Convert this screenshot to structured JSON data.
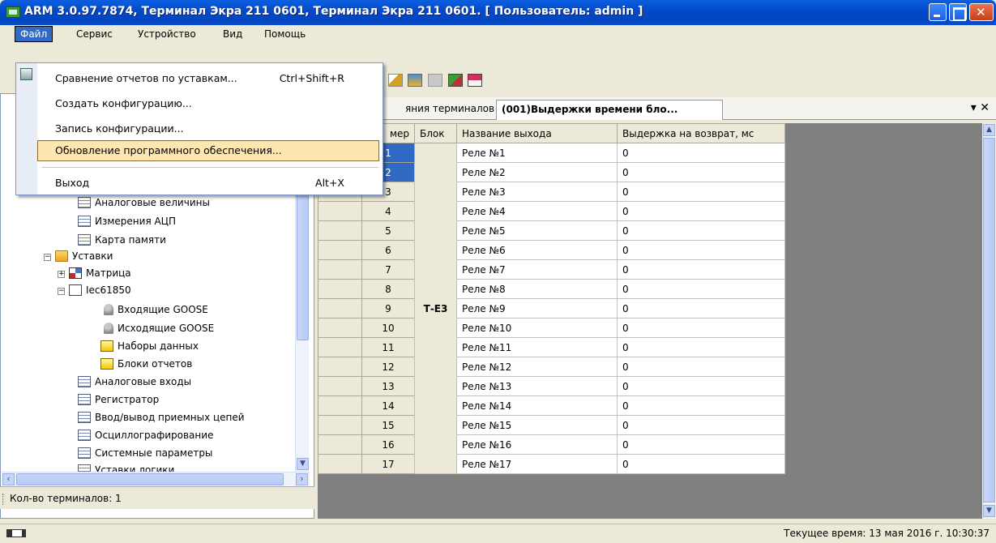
{
  "window": {
    "title": "ARM 3.0.97.7874, Терминал Экра 211 0601, Терминал Экра 211 0601. [ Пользователь: admin ]"
  },
  "menubar": [
    "Файл",
    "Сервис",
    "Устройство",
    "Вид",
    "Помощь"
  ],
  "file_menu": {
    "items": [
      {
        "label": "Сравнение отчетов по уставкам...",
        "shortcut": "Ctrl+Shift+R"
      },
      {
        "label": "Создать конфигурацию...",
        "shortcut": ""
      },
      {
        "label": "Запись конфигурации...",
        "shortcut": ""
      },
      {
        "label": "Обновление программного обеспечения...",
        "shortcut": ""
      },
      {
        "label": "Выход",
        "shortcut": "Alt+X"
      }
    ],
    "highlighted": "Обновление программного обеспечения..."
  },
  "tree": [
    "Аналоговые величины",
    "Измерения АЦП",
    "Карта памяти",
    "Уставки",
    "Матрица",
    "Iec61850",
    "Входящие GOOSE",
    "Исходящие GOOSE",
    "Наборы данных",
    "Блоки отчетов",
    "Аналоговые входы",
    "Регистратор",
    "Ввод/вывод приемных цепей",
    "Осциллографирование",
    "Системные параметры",
    "Уставки логики"
  ],
  "left_footer": "Кол-во терминалов: 1",
  "tabs": [
    "яния терминалов",
    "(001)Выдержки времени бло..."
  ],
  "tab_controls": "▾ ✕",
  "grid": {
    "headers": [
      "мер",
      "Блок",
      "Название выхода",
      "Выдержка на возврат, мс"
    ],
    "block": "Т-Е3",
    "rows": [
      {
        "num": "1",
        "name": "Реле №1",
        "delay": "0"
      },
      {
        "num": "2",
        "name": "Реле №2",
        "delay": "0"
      },
      {
        "num": "3",
        "name": "Реле №3",
        "delay": "0"
      },
      {
        "num": "4",
        "name": "Реле №4",
        "delay": "0"
      },
      {
        "num": "5",
        "name": "Реле №5",
        "delay": "0"
      },
      {
        "num": "6",
        "name": "Реле №6",
        "delay": "0"
      },
      {
        "num": "7",
        "name": "Реле №7",
        "delay": "0"
      },
      {
        "num": "8",
        "name": "Реле №8",
        "delay": "0"
      },
      {
        "num": "9",
        "name": "Реле №9",
        "delay": "0"
      },
      {
        "num": "10",
        "name": "Реле №10",
        "delay": "0"
      },
      {
        "num": "11",
        "name": "Реле №11",
        "delay": "0"
      },
      {
        "num": "12",
        "name": "Реле №12",
        "delay": "0"
      },
      {
        "num": "13",
        "name": "Реле №13",
        "delay": "0"
      },
      {
        "num": "14",
        "name": "Реле №14",
        "delay": "0"
      },
      {
        "num": "15",
        "name": "Реле №15",
        "delay": "0"
      },
      {
        "num": "16",
        "name": "Реле №16",
        "delay": "0"
      },
      {
        "num": "17",
        "name": "Реле №17",
        "delay": "0"
      }
    ]
  },
  "status": {
    "time": "Текущее время: 13 мая 2016 г. 10:30:37"
  },
  "colors": {
    "titlebar": "#0449c9",
    "selection": "#316ac5",
    "menu_hover": "#fde7b0"
  }
}
